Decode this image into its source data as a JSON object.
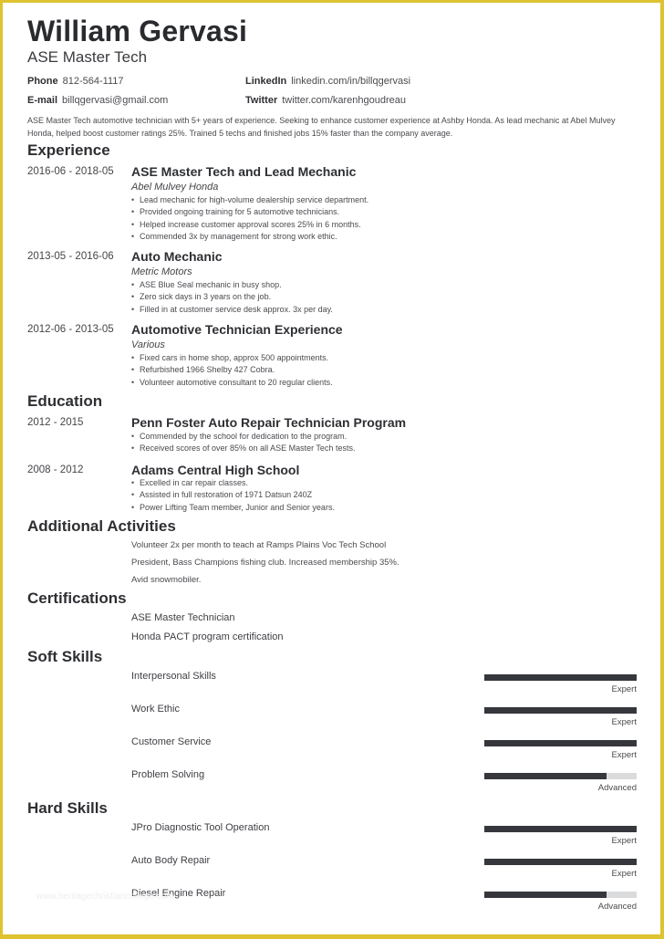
{
  "header": {
    "name": "William Gervasi",
    "title": "ASE Master Tech",
    "contacts": [
      {
        "label": "Phone",
        "value": "812-564-1117"
      },
      {
        "label": "E-mail",
        "value": "billqgervasi@gmail.com"
      },
      {
        "label": "LinkedIn",
        "value": "linkedin.com/in/billqgervasi"
      },
      {
        "label": "Twitter",
        "value": "twitter.com/karenhgoudreau"
      }
    ],
    "summary": "ASE Master Tech automotive technician with 5+ years of experience. Seeking to enhance customer experience at Ashby Honda. As lead mechanic at Abel Mulvey Honda, helped boost customer ratings 25%. Trained 5 techs and finished jobs 15% faster than the company average."
  },
  "experience": {
    "heading": "Experience",
    "items": [
      {
        "dates": "2016-06 - 2018-05",
        "role": "ASE Master Tech and Lead Mechanic",
        "org": "Abel Mulvey Honda",
        "bullets": [
          "Lead mechanic for high-volume dealership service department.",
          "Provided ongoing training for 5 automotive technicians.",
          "Helped increase customer approval scores 25% in 6 months.",
          "Commended 3x by management for strong work ethic."
        ]
      },
      {
        "dates": "2013-05 - 2016-06",
        "role": "Auto Mechanic",
        "org": "Metric Motors",
        "bullets": [
          "ASE Blue Seal mechanic in busy shop.",
          "Zero sick days in 3 years on the job.",
          "Filled in at customer service desk approx. 3x per day."
        ]
      },
      {
        "dates": "2012-06 - 2013-05",
        "role": "Automotive Technician Experience",
        "org": "Various",
        "bullets": [
          "Fixed cars in home shop, approx 500 appointments.",
          "Refurbished 1966 Shelby 427 Cobra.",
          "Volunteer automotive consultant to 20 regular clients."
        ]
      }
    ]
  },
  "education": {
    "heading": "Education",
    "items": [
      {
        "dates": "2012 - 2015",
        "school": "Penn Foster Auto Repair Technician Program",
        "bullets": [
          "Commended by the school for dedication to the program.",
          "Received scores of over 85% on all ASE Master Tech tests."
        ]
      },
      {
        "dates": "2008 - 2012",
        "school": "Adams Central High School",
        "bullets": [
          "Excelled in car repair classes.",
          "Assisted in full restoration of 1971 Datsun 240Z",
          "Power Lifting Team member, Junior and Senior years."
        ]
      }
    ]
  },
  "activities": {
    "heading": "Additional Activities",
    "items": [
      "Volunteer 2x per month to teach at Ramps Plains Voc Tech School",
      "President, Bass Champions fishing club. Increased membership 35%.",
      "Avid snowmobiler."
    ]
  },
  "certifications": {
    "heading": "Certifications",
    "items": [
      "ASE Master Technician",
      "Honda PACT program certification"
    ]
  },
  "soft_skills": {
    "heading": "Soft Skills",
    "items": [
      {
        "name": "Interpersonal Skills",
        "level": "Expert",
        "fill": 1.0
      },
      {
        "name": "Work Ethic",
        "level": "Expert",
        "fill": 1.0
      },
      {
        "name": "Customer Service",
        "level": "Expert",
        "fill": 1.0
      },
      {
        "name": "Problem Solving",
        "level": "Advanced",
        "fill": 0.8
      }
    ]
  },
  "hard_skills": {
    "heading": "Hard Skills",
    "items": [
      {
        "name": "JPro Diagnostic Tool Operation",
        "level": "Expert",
        "fill": 1.0
      },
      {
        "name": "Auto Body Repair",
        "level": "Expert",
        "fill": 1.0
      },
      {
        "name": "Diesel Engine Repair",
        "level": "Advanced",
        "fill": 0.8
      }
    ]
  },
  "watermark": "www.heritagechristiancollege.com",
  "colors": {
    "frame": "#dfc22f",
    "bar_fill": "#35373d",
    "bar_track": "#dadbdd"
  }
}
